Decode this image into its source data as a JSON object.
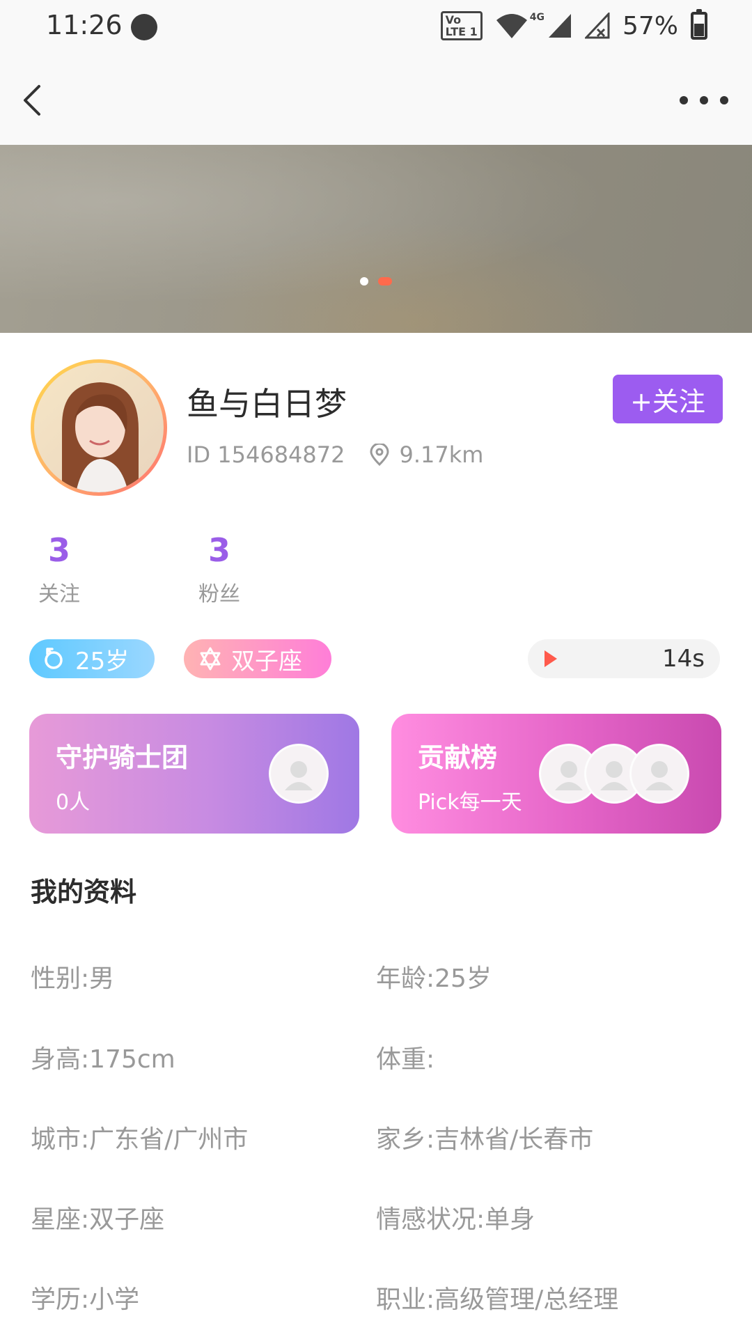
{
  "status_bar": {
    "time": "11:26",
    "volte_line1": "Vo",
    "volte_line2": "LTE 1",
    "network": "4G",
    "battery_percent": "57%",
    "battery_level": 0.57
  },
  "profile": {
    "nickname": "鱼与白日梦",
    "id_text": "ID 154684872",
    "distance": "9.17km",
    "follow_button": "+关注"
  },
  "banner": {
    "page_count": 2,
    "active_index": 1
  },
  "stats": [
    {
      "value": "3",
      "label": "关注"
    },
    {
      "value": "3",
      "label": "粉丝"
    }
  ],
  "tags": {
    "age": "25岁",
    "zodiac": "双子座"
  },
  "voice": {
    "duration": "14s"
  },
  "cards": {
    "guard": {
      "title": "守护骑士团",
      "subtitle": "0人"
    },
    "contribution": {
      "title": "贡献榜",
      "subtitle": "Pick每一天"
    }
  },
  "section_title": "我的资料",
  "profile_info": [
    "性别:男",
    "年龄:25岁",
    "身高:175cm",
    "体重:",
    "城市:广东省/广州市",
    "家乡:吉林省/长春市",
    "星座:双子座",
    "情感状况:单身",
    "学历:小学",
    "职业:高级管理/总经理"
  ],
  "colors": {
    "accent_purple": "#9c5cf0",
    "stat_purple": "#9a5de8",
    "banner_dot_active": "#ff6a4c",
    "play_red": "#ff5a4c"
  }
}
